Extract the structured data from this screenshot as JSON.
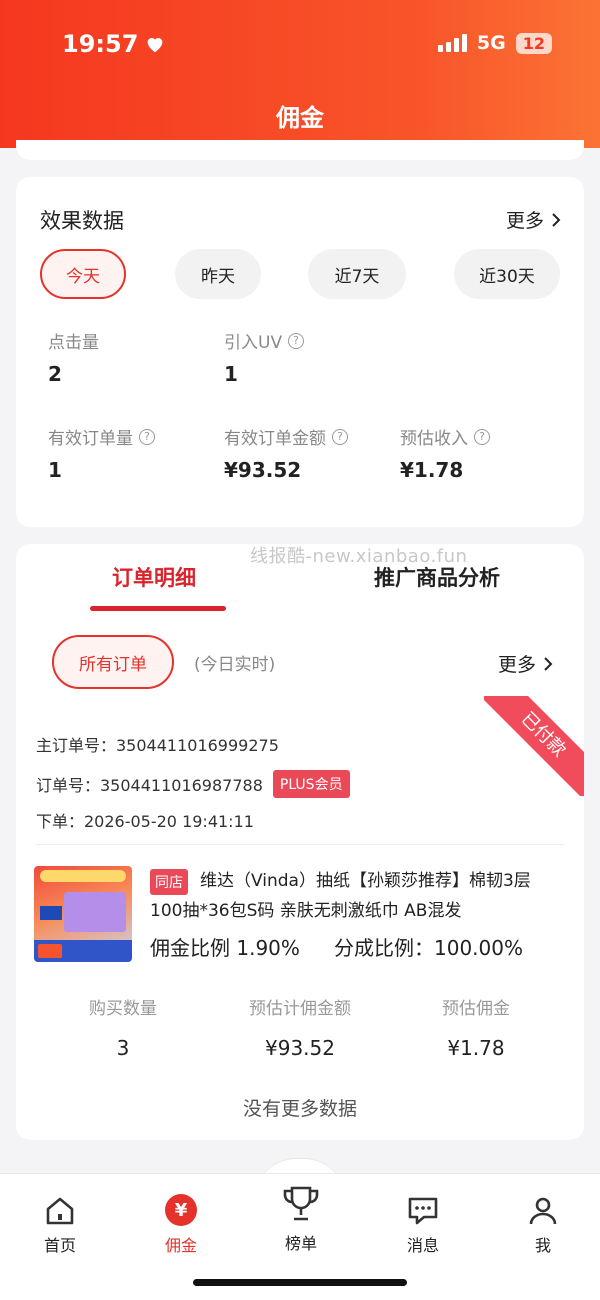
{
  "status_bar": {
    "time": "19:57",
    "network": "5G",
    "battery": "12"
  },
  "header": {
    "title": "佣金"
  },
  "effect": {
    "title": "效果数据",
    "more_label": "更多",
    "periods": [
      "今天",
      "昨天",
      "近7天",
      "近30天"
    ],
    "metrics": [
      {
        "label": "点击量",
        "value": "2",
        "has_help": false
      },
      {
        "label": "引入UV",
        "value": "1",
        "has_help": true
      },
      {
        "label": "有效订单量",
        "value": "1",
        "has_help": true
      },
      {
        "label": "有效订单金额",
        "value": "¥93.52",
        "has_help": true
      },
      {
        "label": "预估收入",
        "value": "¥1.78",
        "has_help": true
      }
    ]
  },
  "orders": {
    "watermark": "线报酷-new.xianbao.fun",
    "tabs": [
      "订单明细",
      "推广商品分析"
    ],
    "filter": "所有订单",
    "filter_note": "(今日实时)",
    "more_label": "更多",
    "status_ribbon": "已付款",
    "main_order": "主订单号：3504411016999275",
    "order_no": "订单号：3504411016987788",
    "plus_badge": "PLUS会员",
    "placed_time": "下单：2026-05-20 19:41:11",
    "product": {
      "store_badge": "同店",
      "title": "维达（Vinda）抽纸【孙颖莎推荐】棉韧3层100抽*36包S码 亲肤无刺激纸巾 AB混发",
      "commission_ratio": "佣金比例 1.90%",
      "share_ratio": "分成比例：100.00%"
    },
    "stats": [
      {
        "label": "购买数量",
        "value": "3"
      },
      {
        "label": "预估计佣金额",
        "value": "¥93.52"
      },
      {
        "label": "预估佣金",
        "value": "¥1.78"
      }
    ],
    "no_more": "没有更多数据"
  },
  "tabbar": {
    "items": [
      "首页",
      "佣金",
      "榜单",
      "消息",
      "我"
    ],
    "active": "佣金",
    "yen_symbol": "¥"
  }
}
